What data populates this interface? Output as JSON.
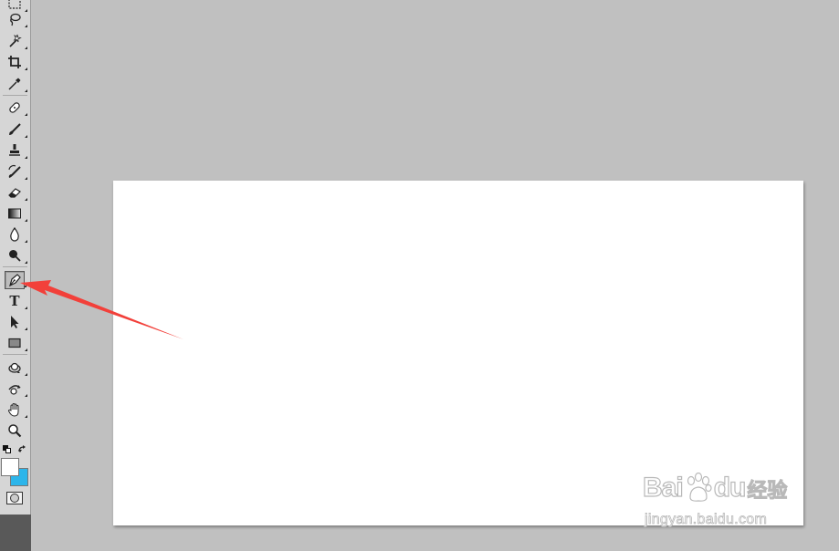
{
  "toolbar": {
    "tools": [
      {
        "id": "marquee",
        "icon": "rectangular-marquee-icon"
      },
      {
        "id": "lasso",
        "icon": "lasso-icon"
      },
      {
        "id": "magic-wand",
        "icon": "magic-wand-icon"
      },
      {
        "id": "crop",
        "icon": "crop-icon"
      },
      {
        "id": "eyedropper",
        "icon": "eyedropper-icon"
      },
      {
        "id": "healing",
        "icon": "healing-brush-icon"
      },
      {
        "id": "brush",
        "icon": "brush-icon"
      },
      {
        "id": "clone-stamp",
        "icon": "clone-stamp-icon"
      },
      {
        "id": "history-brush",
        "icon": "history-brush-icon"
      },
      {
        "id": "eraser",
        "icon": "eraser-icon"
      },
      {
        "id": "gradient",
        "icon": "gradient-icon"
      },
      {
        "id": "blur",
        "icon": "blur-drop-icon"
      },
      {
        "id": "dodge",
        "icon": "dodge-icon"
      },
      {
        "id": "pen",
        "icon": "pen-icon",
        "active": true
      },
      {
        "id": "type",
        "icon": "type-icon"
      },
      {
        "id": "path-selection",
        "icon": "path-selection-arrow-icon"
      },
      {
        "id": "shape",
        "icon": "rectangle-shape-icon"
      },
      {
        "id": "3d-rotate",
        "icon": "3d-rotate-icon"
      },
      {
        "id": "3d-orbit",
        "icon": "3d-orbit-icon"
      },
      {
        "id": "hand",
        "icon": "hand-icon"
      },
      {
        "id": "zoom",
        "icon": "zoom-icon"
      }
    ],
    "type_glyph": "T",
    "foreground_color": "#ffffff",
    "background_color": "#2cb5ea"
  },
  "canvas": {
    "color": "#ffffff"
  },
  "annotation": {
    "arrow_color": "#f2403a",
    "points_to": "pen-tool"
  },
  "watermark": {
    "brand_left": "Bai",
    "brand_right": "du",
    "brand_cn": "经验",
    "url": "jingyan.baidu.com"
  },
  "colors": {
    "workspace": "#c0c0c0",
    "toolbar": "#d6d6d6"
  }
}
